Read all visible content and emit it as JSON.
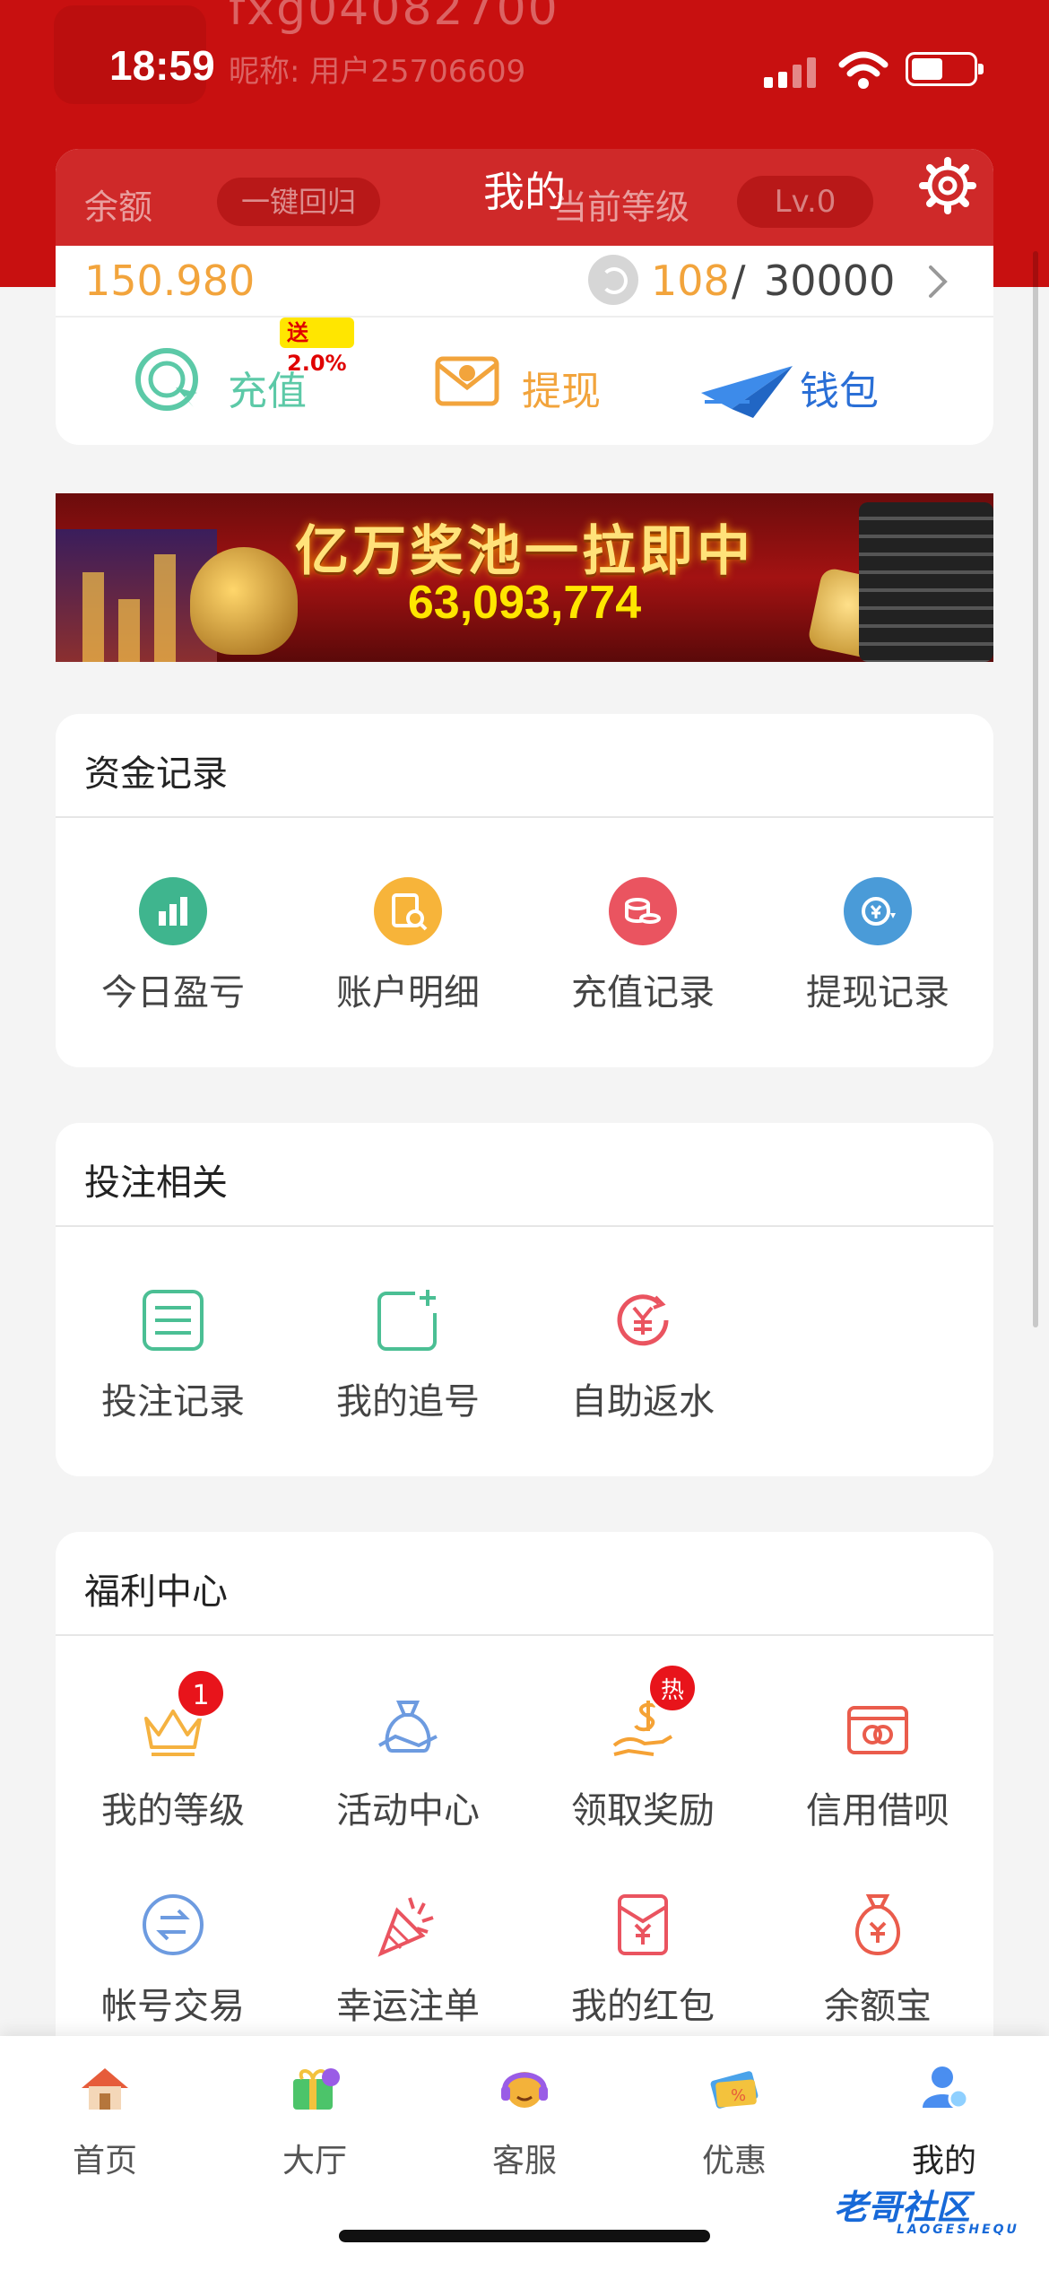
{
  "status_bar": {
    "time": "18:59"
  },
  "header_ghost": {
    "username": "fxg04082700",
    "nickname": "昵称: 用户25706609"
  },
  "page": {
    "title": "我的"
  },
  "account": {
    "balance_label": "余额",
    "one_click_label": "一键回归",
    "level_label": "当前等级",
    "level_value": "Lv.0",
    "balance_value": "150.980",
    "exp_current": "108",
    "exp_separator": "/",
    "exp_max": "30000",
    "actions": [
      {
        "label": "充值",
        "icon": "recharge-icon",
        "tag": "送2.0%"
      },
      {
        "label": "提现",
        "icon": "withdraw-icon"
      },
      {
        "label": "钱包",
        "icon": "wallet-icon"
      }
    ]
  },
  "banner": {
    "title": "亿万奖池一拉即中",
    "amount": "63,093,774"
  },
  "funds": {
    "title": "资金记录",
    "items": [
      {
        "label": "今日盈亏",
        "icon": "chart-icon",
        "color": "#3fb58e"
      },
      {
        "label": "账户明细",
        "icon": "document-search-icon",
        "color": "#f7b43a"
      },
      {
        "label": "充值记录",
        "icon": "coins-icon",
        "color": "#ea5460"
      },
      {
        "label": "提现记录",
        "icon": "yuan-exchange-icon",
        "color": "#4a9bd8"
      }
    ]
  },
  "betting": {
    "title": "投注相关",
    "items": [
      {
        "label": "投注记录",
        "icon": "list-icon"
      },
      {
        "label": "我的追号",
        "icon": "add-square-icon"
      },
      {
        "label": "自助返水",
        "icon": "yuan-refresh-icon"
      }
    ]
  },
  "welfare": {
    "title": "福利中心",
    "items": [
      {
        "label": "我的等级",
        "icon": "crown-icon",
        "badge": "1"
      },
      {
        "label": "活动中心",
        "icon": "gift-bag-icon"
      },
      {
        "label": "领取奖励",
        "icon": "dollar-hand-icon",
        "badge": "热"
      },
      {
        "label": "信用借呗",
        "icon": "card-icon"
      },
      {
        "label": "帐号交易",
        "icon": "swap-icon"
      },
      {
        "label": "幸运注单",
        "icon": "party-popper-icon"
      },
      {
        "label": "我的红包",
        "icon": "red-envelope-icon"
      },
      {
        "label": "余额宝",
        "icon": "money-bag-icon"
      }
    ]
  },
  "tabbar": {
    "items": [
      {
        "label": "首页",
        "icon": "home-icon"
      },
      {
        "label": "大厅",
        "icon": "lobby-gift-icon"
      },
      {
        "label": "客服",
        "icon": "support-icon"
      },
      {
        "label": "优惠",
        "icon": "coupon-icon"
      },
      {
        "label": "我的",
        "icon": "profile-icon",
        "active": true
      }
    ]
  },
  "watermark": {
    "text": "老哥社区",
    "sub": "LAOGESHEQU"
  },
  "colors": {
    "brand_red": "#c81010",
    "accent_orange": "#f2a43c",
    "card_bg": "#ffffff",
    "page_bg": "#f4f4f4"
  }
}
